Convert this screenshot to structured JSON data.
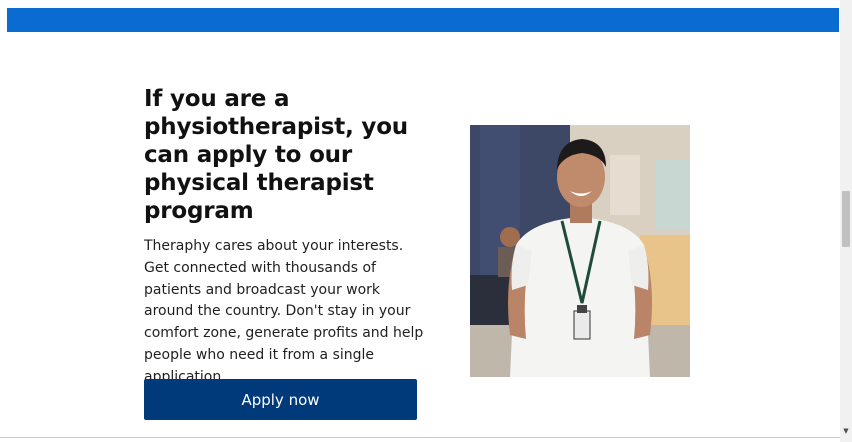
{
  "header": {
    "bar_color": "#0a6bd1"
  },
  "hero": {
    "title": "If you are a physiotherapist, you can apply to our physical therapist program",
    "description": "Theraphy cares about your interests. Get connected with thousands of patients and broadcast your work around the country. Don't stay in your comfort zone, generate profits and help people who need it from a single application.",
    "apply_label": "Apply now",
    "apply_color": "#003a7a",
    "image": "smiling-physiotherapist-photo"
  },
  "scrollbar": {
    "down_arrow_icon": "chevron-down-icon"
  }
}
